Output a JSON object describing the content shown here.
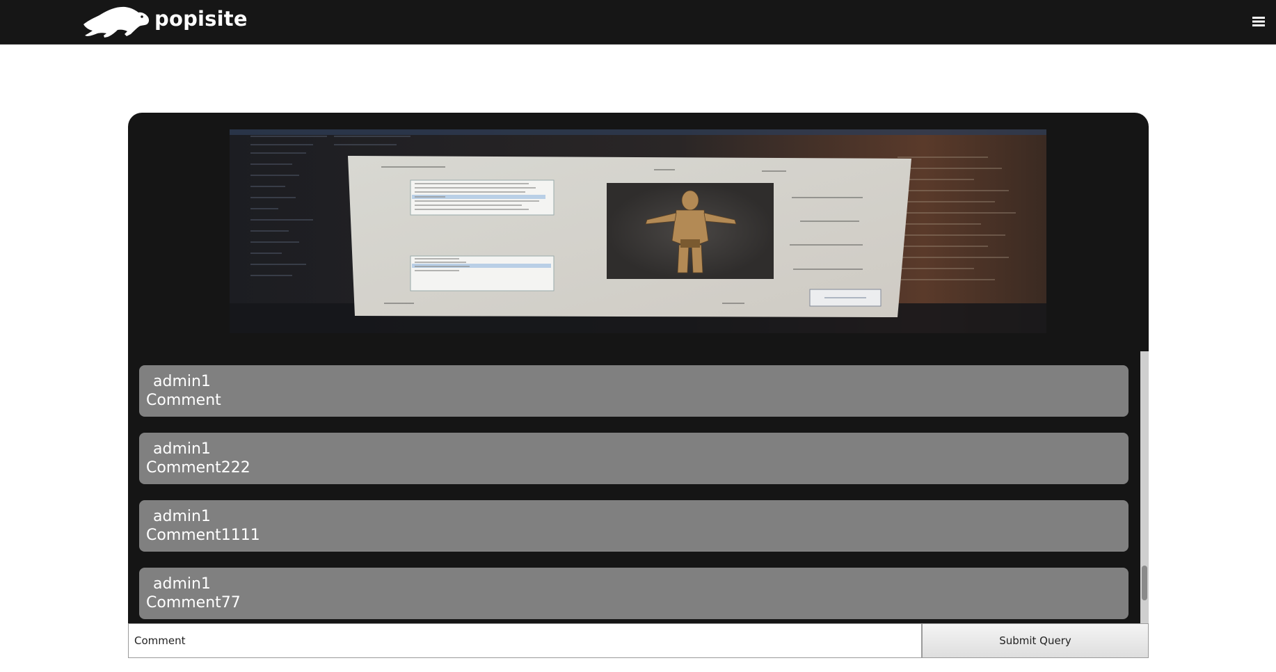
{
  "brand": {
    "name": "popisite",
    "logo_icon": "panther-icon"
  },
  "nav": {
    "menu_icon": "hamburger-menu-icon"
  },
  "post": {
    "image_icon": "game-screenshot-image"
  },
  "comments": [
    {
      "author": "admin1",
      "text": "Comment"
    },
    {
      "author": "admin1",
      "text": "Comment222"
    },
    {
      "author": "admin1",
      "text": "Comment1111"
    },
    {
      "author": "admin1",
      "text": "Comment77"
    }
  ],
  "form": {
    "input_value": "Comment",
    "submit_label": "Submit Query"
  },
  "colors": {
    "navbar": "#161616",
    "panel": "#151515",
    "comment_bg": "#808080",
    "comment_text": "#ffffff"
  }
}
